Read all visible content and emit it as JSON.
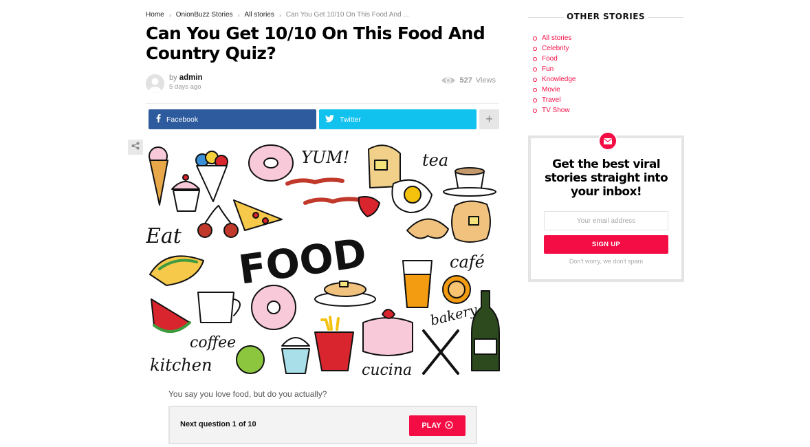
{
  "breadcrumb": {
    "items": [
      "Home",
      "OnionBuzz Stories",
      "All stories"
    ],
    "current": "Can You Get 10/10 On This Food And ..."
  },
  "article": {
    "title": "Can You Get 10/10 On This Food And Country Quiz?",
    "by_prefix": "by",
    "author": "admin",
    "date": "5 days ago",
    "views_count": "527",
    "views_label": "Views",
    "intro": "You say you love food, but do you actually?"
  },
  "share": {
    "facebook_label": "Facebook",
    "twitter_label": "Twitter",
    "more_label": "+"
  },
  "image_text": {
    "yum": "YUM!",
    "tea": "tea",
    "eat": "Eat",
    "food": "FOOD",
    "cafe": "café",
    "coffee": "coffee",
    "kitchen": "kitchen",
    "bakery": "bakery",
    "cucina": "cucina"
  },
  "quiz": {
    "next_label": "Next question 1 of 10",
    "play_label": "PLAY"
  },
  "sidebar": {
    "title": "OTHER STORIES",
    "items": [
      "All stories",
      "Celebrity",
      "Food",
      "Fun",
      "Knowledge",
      "Movie",
      "Travel",
      "TV Show"
    ]
  },
  "newsletter": {
    "heading": "Get the best viral stories straight into your inbox!",
    "email_placeholder": "Your email address",
    "signup_label": "SIGN UP",
    "note": "Don't worry, we don't spam"
  },
  "colors": {
    "accent": "#f40d45",
    "facebook": "#2d5b9e",
    "twitter": "#11c2ee"
  }
}
